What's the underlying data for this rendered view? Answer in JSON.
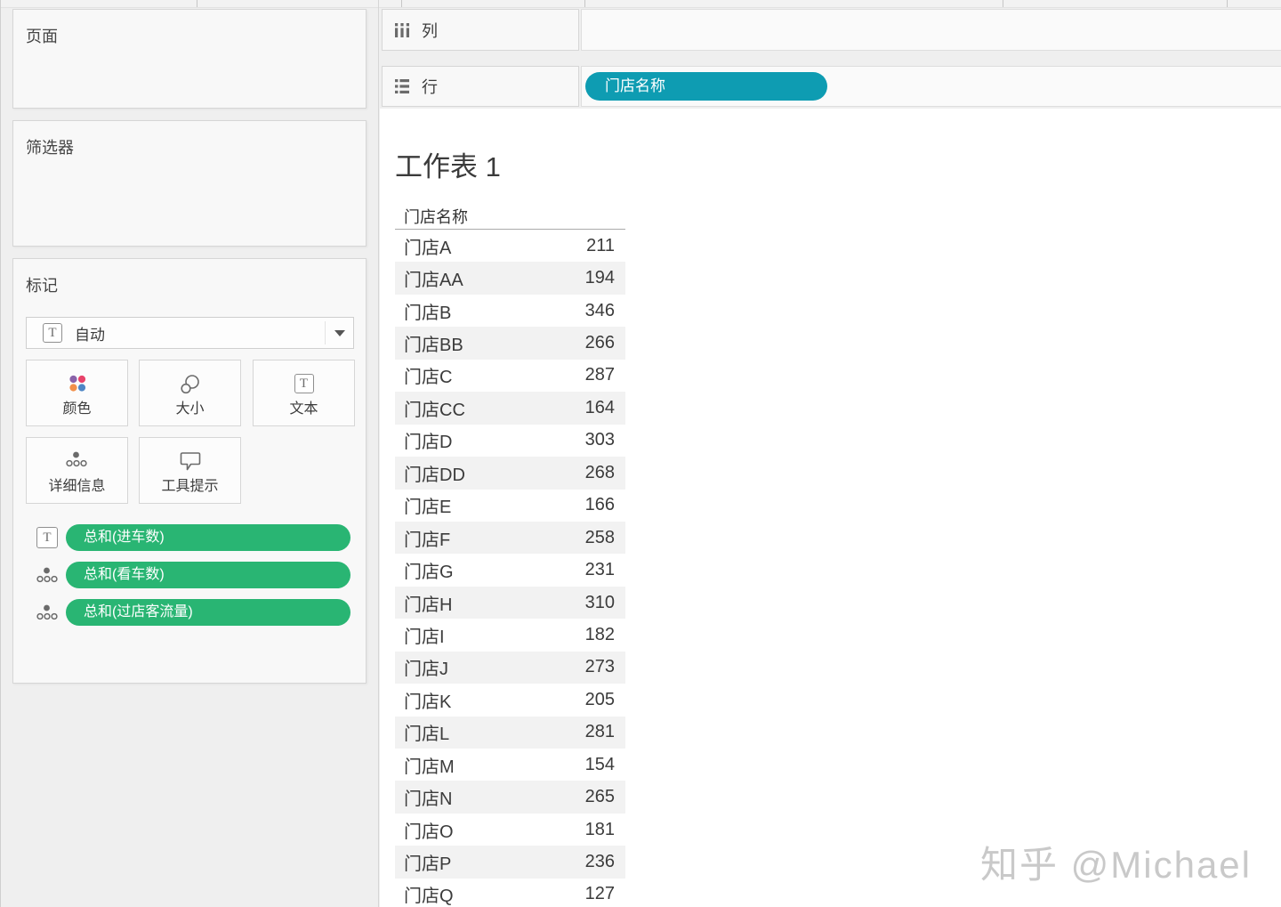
{
  "shelves": {
    "columns": {
      "label": "列"
    },
    "rows": {
      "label": "行",
      "pill": "门店名称"
    }
  },
  "panels": {
    "pages": {
      "label": "页面"
    },
    "filters": {
      "label": "筛选器"
    },
    "marks": {
      "label": "标记",
      "mark_type": "自动",
      "buttons": [
        {
          "label": "颜色"
        },
        {
          "label": "大小"
        },
        {
          "label": "文本"
        },
        {
          "label": "详细信息"
        },
        {
          "label": "工具提示"
        }
      ],
      "pills": [
        {
          "label": "总和(进车数)"
        },
        {
          "label": "总和(看车数)"
        },
        {
          "label": "总和(过店客流量)"
        }
      ]
    }
  },
  "sheet": {
    "title": "工作表 1",
    "table": {
      "header": "门店名称",
      "rows": [
        {
          "name": "门店A",
          "value": 211
        },
        {
          "name": "门店AA",
          "value": 194
        },
        {
          "name": "门店B",
          "value": 346
        },
        {
          "name": "门店BB",
          "value": 266
        },
        {
          "name": "门店C",
          "value": 287
        },
        {
          "name": "门店CC",
          "value": 164
        },
        {
          "name": "门店D",
          "value": 303
        },
        {
          "name": "门店DD",
          "value": 268
        },
        {
          "name": "门店E",
          "value": 166
        },
        {
          "name": "门店F",
          "value": 258
        },
        {
          "name": "门店G",
          "value": 231
        },
        {
          "name": "门店H",
          "value": 310
        },
        {
          "name": "门店I",
          "value": 182
        },
        {
          "name": "门店J",
          "value": 273
        },
        {
          "name": "门店K",
          "value": 205
        },
        {
          "name": "门店L",
          "value": 281
        },
        {
          "name": "门店M",
          "value": 154
        },
        {
          "name": "门店N",
          "value": 265
        },
        {
          "name": "门店O",
          "value": 181
        },
        {
          "name": "门店P",
          "value": 236
        },
        {
          "name": "门店Q",
          "value": 127
        }
      ]
    }
  },
  "watermark": "知乎 @Michael",
  "colors": {
    "dimension_pill": "#0e9cb2",
    "measure_pill": "#29b573"
  }
}
